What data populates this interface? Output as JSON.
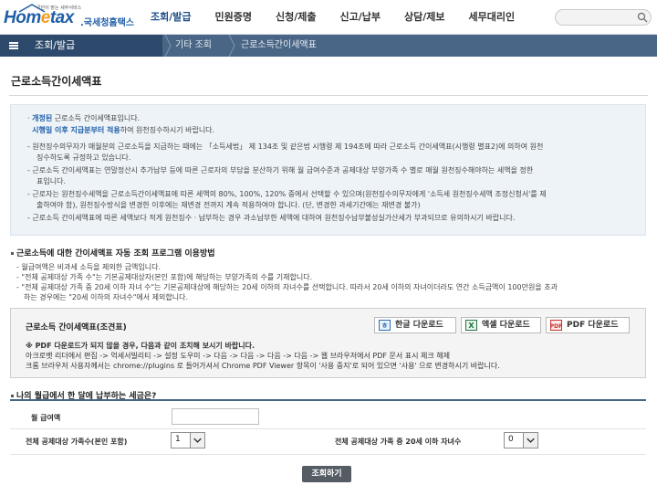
{
  "header": {
    "logo_tagline": "국민이 맡는 세무서비스",
    "logo_main_a": "Hom",
    "logo_main_e": "e",
    "logo_main_b": "tax",
    "logo_kr": ".국세청홈택스",
    "nav": [
      "조회/발급",
      "민원증명",
      "신청/제출",
      "신고/납부",
      "상담/제보",
      "세무대리인"
    ]
  },
  "breadcrumb": {
    "current": "조회/발급",
    "items": [
      "기타 조회",
      "근로소득간이세액표"
    ]
  },
  "page": {
    "title": "근로소득간이세액표"
  },
  "notice": {
    "line1_label": "개정된",
    "line1_rest": " 근로소득 간이세액표입니다.",
    "line2_label": "시행일 이후 지급분부터 적용",
    "line2_rest": "하여 원천징수하시기 바랍니다.",
    "bullets": [
      "- 원천징수의무자가 매월분의 근로소득을 지급하는 때에는 「소득세법」 제 134조 및 같은법 시행령 제 194조에 따라 근로소득 간이세액표(시행령 별표2)에 의하여 원천",
      "징수하도록 규정하고 있습니다.",
      "- 근로소득 간이세액표는 연말정산시 추가납부 등에 따른 근로자의 부담을 분산하기 위해 월 급여수준과 공제대상 부양가족 수 별로 매월 원천징수해야하는 세액을 정한",
      "표입니다.",
      "- 근로자는 원천징수세액을 근로소득간이세액표에 따른 세액의 80%, 100%, 120% 중에서 선택할 수 있으며(원천징수의무자에게 '소득세 원천징수세액 조정신청서'를 제",
      "출하여야 함), 원천징수방식을 변경한 이후에는 재변경 전까지 계속 적용하여야 합니다. (단, 변경한 과세기간에는 재변경 불가)",
      "- 근로소득 간이세액표에 따른 세액보다 적게 원천징수 · 납부하는 경우 과소납부한 세액에 대하여 원천징수납부불성실가산세가 부과되므로 유의하시기 바랍니다."
    ]
  },
  "auto_calc": {
    "title": "근로소득에 대한 간이세액표 자동 조회 프로그램 이용방법",
    "lines": [
      "- 월급여액은 비과세 소득을 제외한 금액입니다.",
      "- \"전체 공제대상 가족 수\"는 기본공제대상자(본인 포함)에 해당하는 부양가족의 수를 기재합니다.",
      "- \"전체 공제대상 가족 중 20세 이하 자녀 수\"는 기본공제대상에 해당하는 20세 이하의 자녀수를 선택합니다. 따라서 20세 이하의 자녀이더라도 연간 소득금액이 100만원을 초과",
      "하는 경우에는 \"20세 이하의 자녀수\"에서 제외합니다."
    ]
  },
  "download": {
    "title": "근로소득 간이세액표(조견표)",
    "buttons": [
      "한글 다운로드",
      "엑셀 다운로드",
      "PDF 다운로드"
    ],
    "notes": [
      "※ PDF 다운로드가 되지 않을 경우, 다음과 같이 조치해 보시기 바랍니다.",
      "아크로뱃 리더에서 편집 -> 억세서빌리티 -> 설정 도우미 -> 다음 -> 다음 -> 다음 -> 다음 -> 웹 브라우저에서 PDF 문서 표시 체크 해제",
      "크롬 브라우저 사용자께서는 chrome://plugins 로 들어가셔서 Chrome PDF Viewer 항목이 '사용 중지'로 되어 있으면 '사용' 으로 변경하시기 바랍니다."
    ]
  },
  "form": {
    "title": "나의 월급에서 한 달에 납부하는 세금은?",
    "salary_label": "월 급여액",
    "salary_value": "",
    "family_label": "전체 공제대상 가족수(본인 포함)",
    "family_value": "1",
    "children_label": "전체 공제대상 가족 중 20세 이하 자녀수",
    "children_value": "0",
    "submit_label": "조회하기"
  }
}
